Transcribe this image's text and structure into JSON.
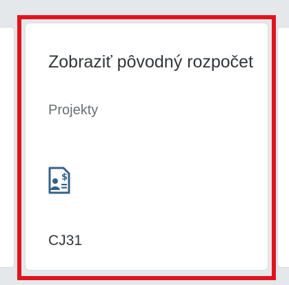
{
  "tile": {
    "title": "Zobraziť pôvodný rozpočet",
    "subtitle": "Projekty",
    "footer": "CJ31",
    "icon": "budget-document-icon",
    "currency_symbol": "$"
  },
  "colors": {
    "background": "#e5e8ea",
    "tile": "#ffffff",
    "highlight": "#e0141e",
    "icon": "#346187",
    "title_text": "#32363a",
    "subtitle_text": "#6a6d70"
  }
}
